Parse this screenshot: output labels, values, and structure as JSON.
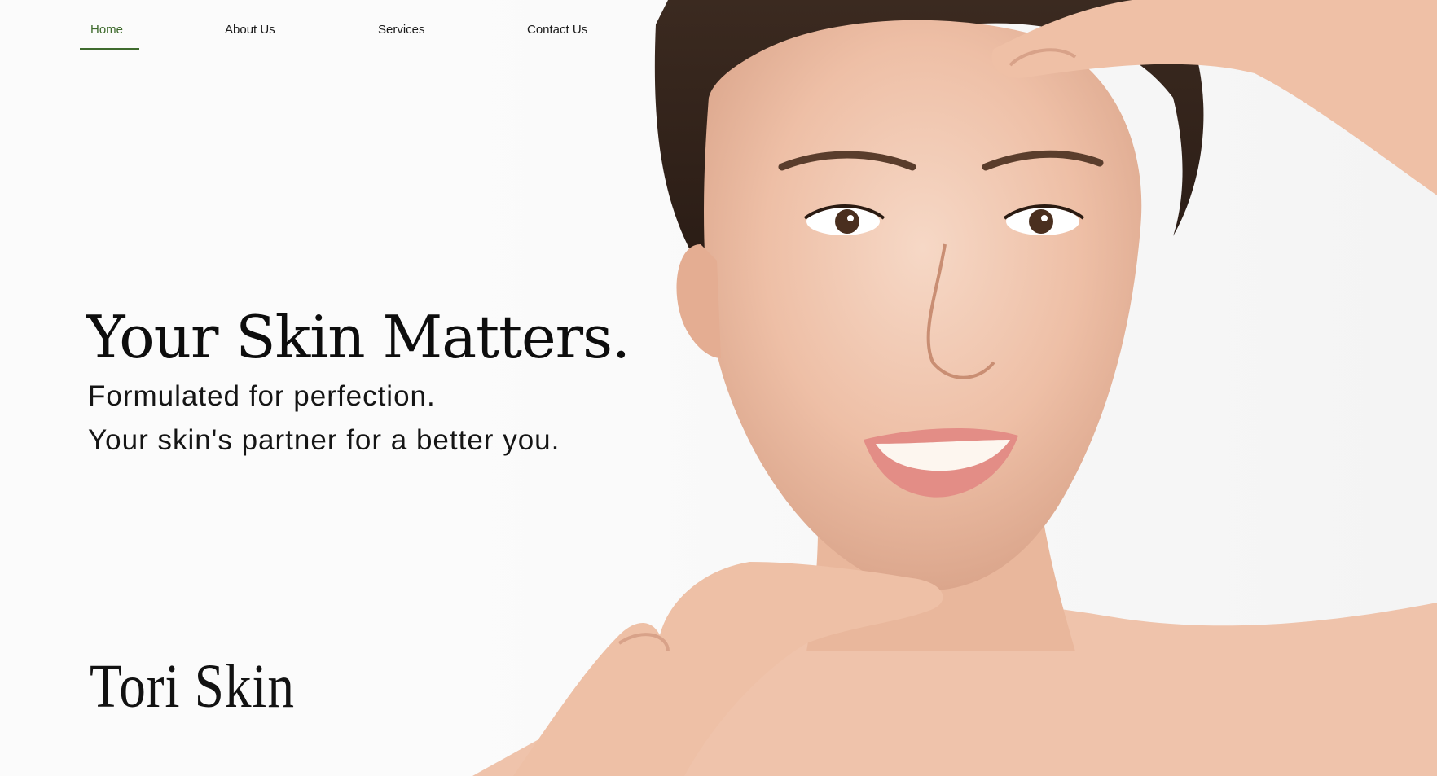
{
  "nav": {
    "items": [
      {
        "label": "Home",
        "active": true
      },
      {
        "label": "About Us",
        "active": false
      },
      {
        "label": "Services",
        "active": false
      },
      {
        "label": "Contact Us",
        "active": false
      }
    ]
  },
  "hero": {
    "headline": "Your Skin Matters.",
    "subline_1": "Formulated for perfection.",
    "subline_2": "Your skin's partner for a better you."
  },
  "brand": {
    "name": "Tori Skin"
  },
  "colors": {
    "accent": "#3f6b2e",
    "background": "#fbfbfb",
    "text": "#111111"
  }
}
